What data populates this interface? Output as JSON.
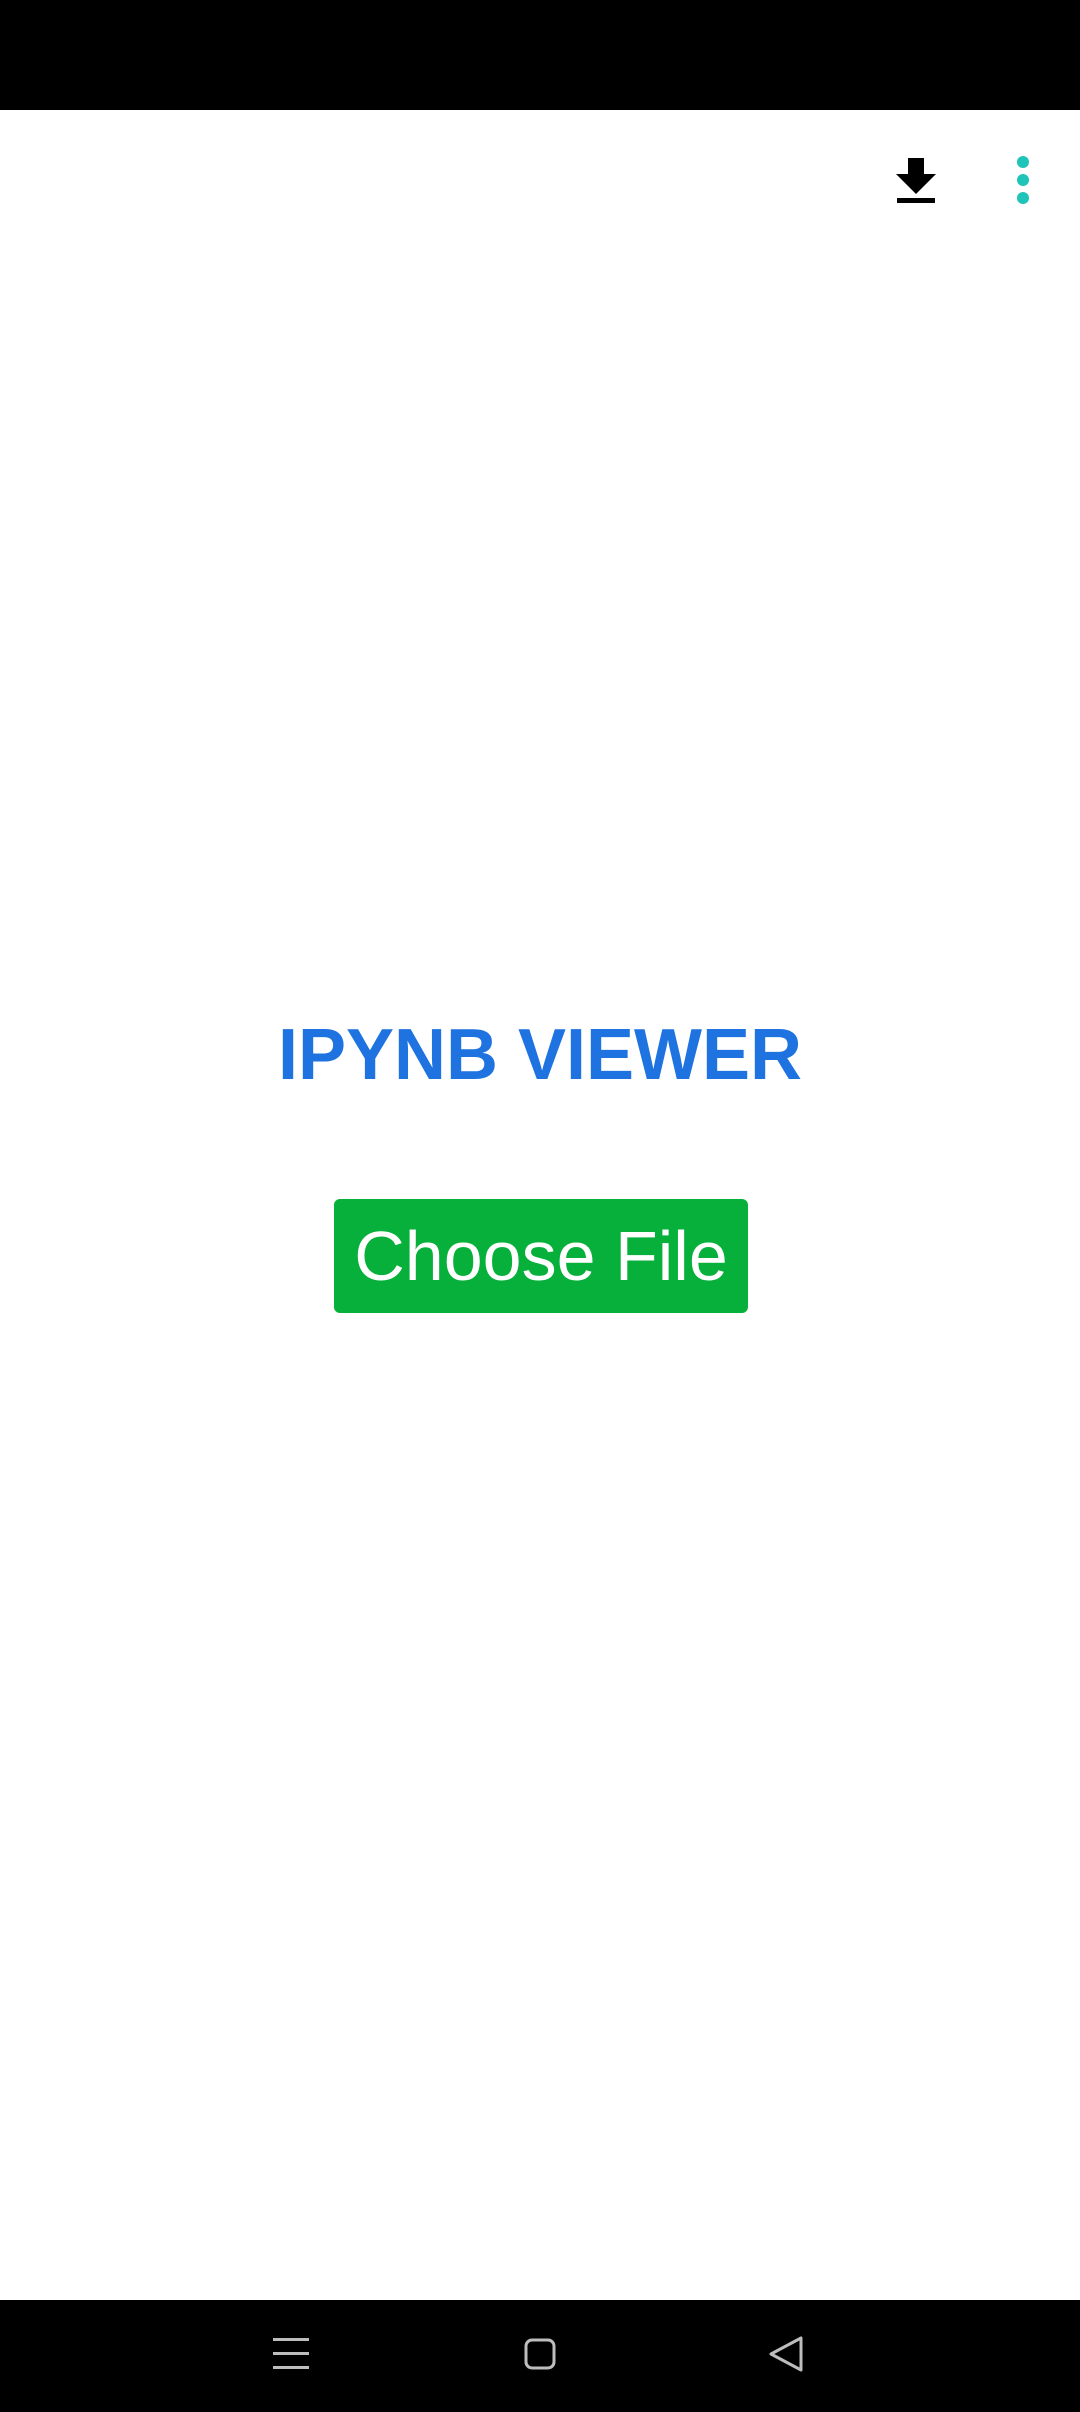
{
  "app": {
    "title": "IPYNB VIEWER",
    "choose_file_label": "Choose File"
  },
  "toolbar": {
    "icons": [
      "download-icon",
      "more-vertical-icon"
    ]
  },
  "navigation": {
    "icons": [
      "menu-icon",
      "home-icon",
      "back-icon"
    ]
  },
  "colors": {
    "title": "#1e73e1",
    "button": "#06b03a",
    "button_text": "#ffffff",
    "overflow_icon": "#1fc4b8",
    "bars": "#000000"
  }
}
